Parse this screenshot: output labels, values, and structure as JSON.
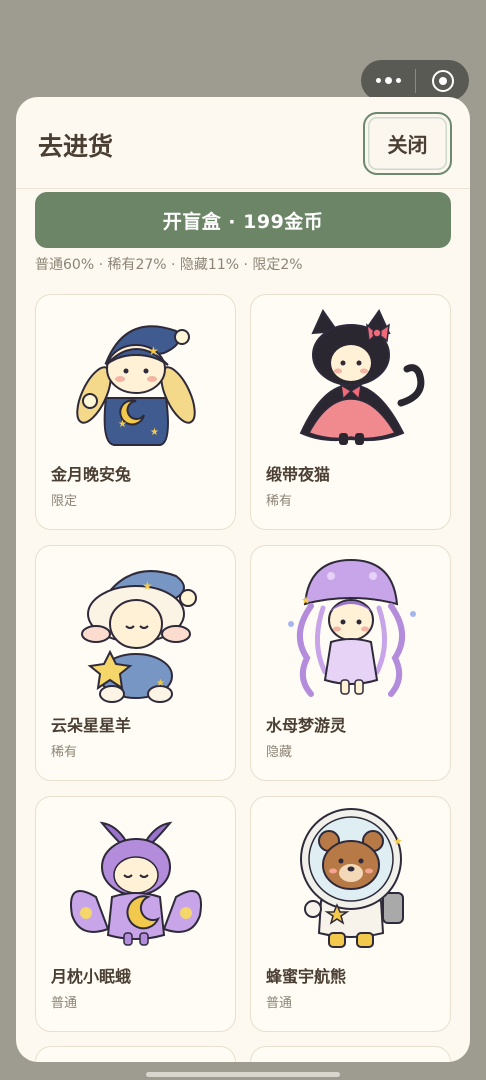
{
  "sheet": {
    "title": "去进货",
    "close_label": "关闭",
    "open_box_label": "开盲盒 · 199金币",
    "rates": "普通60% · 稀有27% · 隐藏11% · 限定2%"
  },
  "items": [
    {
      "name": "金月晚安兔",
      "rarity": "限定",
      "icon": "bunny-icon"
    },
    {
      "name": "缎带夜猫",
      "rarity": "稀有",
      "icon": "cat-icon"
    },
    {
      "name": "云朵星星羊",
      "rarity": "稀有",
      "icon": "sheep-icon"
    },
    {
      "name": "水母梦游灵",
      "rarity": "隐藏",
      "icon": "jellyfish-icon"
    },
    {
      "name": "月枕小眠蛾",
      "rarity": "普通",
      "icon": "moth-icon"
    },
    {
      "name": "蜂蜜宇航熊",
      "rarity": "普通",
      "icon": "bear-icon"
    }
  ],
  "colors": {
    "accent": "#6c8567",
    "background": "#fdf9f0",
    "text": "#4b3e32",
    "muted": "#8d8476"
  }
}
